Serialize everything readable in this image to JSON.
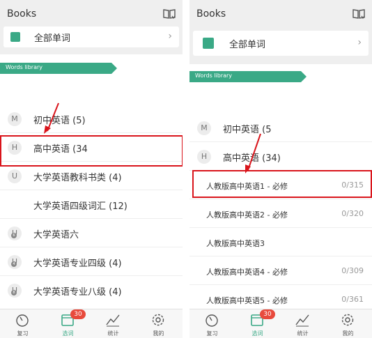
{
  "left": {
    "title": "Books",
    "all_words_label": "全部单词",
    "library_ribbon": "Words library",
    "items": [
      {
        "badge": "M",
        "label": "初中英语 (5)",
        "sub": ""
      },
      {
        "badge": "H",
        "label": "高中英语 (34",
        "sub": ""
      },
      {
        "badge": "U",
        "label": "大学英语教科书类 (4)",
        "sub": ""
      },
      {
        "badge": "",
        "label": "大学英语四级词汇 (12)",
        "sub": ""
      },
      {
        "badge": "U",
        "label": "大学英语六",
        "sub": "6"
      },
      {
        "badge": "U",
        "label": "大学英语专业四级 (4)",
        "sub": "4"
      },
      {
        "badge": "U",
        "label": "大学英语专业八级 (4)",
        "sub": "8"
      }
    ],
    "tabs": [
      {
        "label": "复习"
      },
      {
        "label": "选词",
        "badge": "30"
      },
      {
        "label": "统计"
      },
      {
        "label": "我的"
      }
    ]
  },
  "right": {
    "title": "Books",
    "all_words_label": "全部单词",
    "library_ribbon": "Words library",
    "items": [
      {
        "badge": "M",
        "label": "初中英语 (5"
      },
      {
        "badge": "H",
        "label": "高中英语 (34)"
      }
    ],
    "books": [
      {
        "label": "人教版高中英语1 - 必修",
        "count": "0/315"
      },
      {
        "label": "人教版高中英语2 - 必修",
        "count": "0/320"
      },
      {
        "label": "人教版高中英语3",
        "count": ""
      },
      {
        "label": "人教版高中英语4 - 必修",
        "count": "0/309"
      },
      {
        "label": "人教版高中英语5 - 必修",
        "count": "0/361"
      }
    ],
    "tabs": [
      {
        "label": "复习"
      },
      {
        "label": "选词",
        "badge": "30"
      },
      {
        "label": "统计"
      },
      {
        "label": "我的"
      }
    ]
  },
  "colors": {
    "accent": "#3aa986",
    "highlight": "#d9141b",
    "notification": "#e84a3c"
  }
}
